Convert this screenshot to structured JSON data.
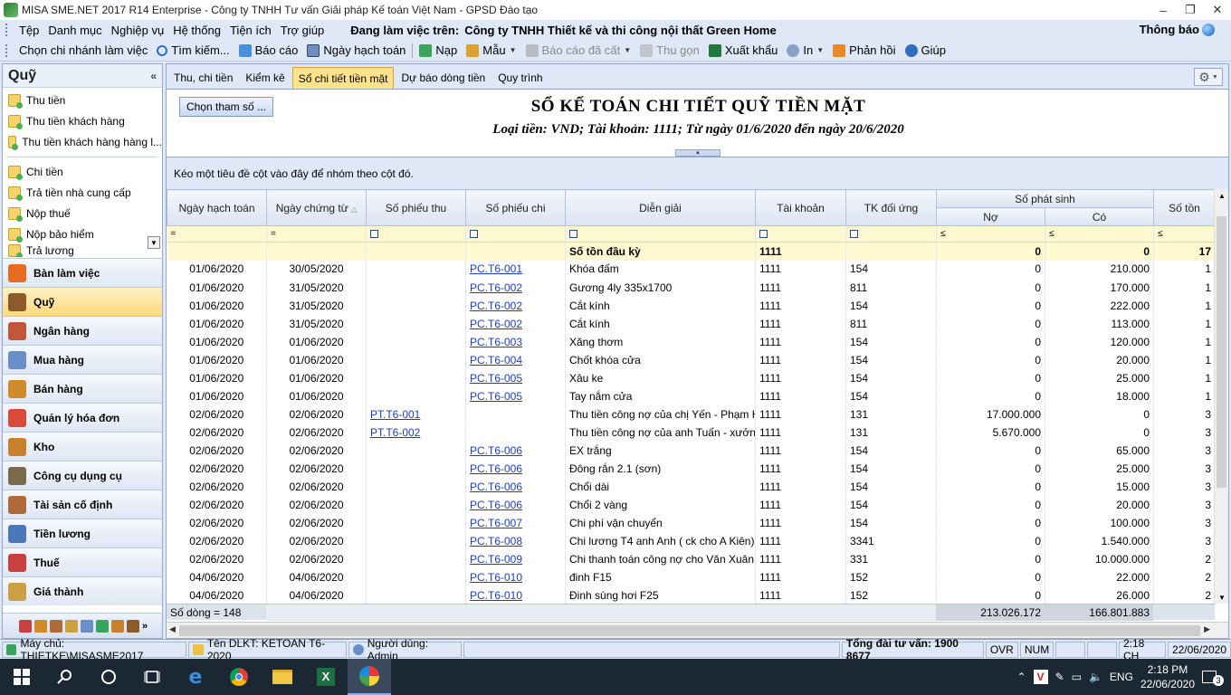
{
  "window": {
    "title": "MISA SME.NET 2017 R14 Enterprise - Công ty TNHH Tư vấn Giải pháp Kế toán Việt Nam - GPSD Đào tạo",
    "controls": [
      "–",
      "❐",
      "✕"
    ]
  },
  "menu": {
    "items": [
      "Tệp",
      "Danh mục",
      "Nghiệp vụ",
      "Hệ thống",
      "Tiện ích",
      "Trợ giúp"
    ],
    "working_label": "Đang làm việc trên:",
    "company": "Công ty TNHH Thiết kế và thi công nội thất Green Home",
    "notify": "Thông báo"
  },
  "toolbar": {
    "branch": "Chọn chi nhánh làm việc",
    "search": "Tìm kiếm...",
    "report": "Báo cáo",
    "date": "Ngày hạch toán",
    "load": "Nạp",
    "template": "Mẫu",
    "saved": "Báo cáo đã cất",
    "compact": "Thu gọn",
    "export": "Xuất khẩu",
    "print": "In",
    "feedback": "Phản hồi",
    "help": "Giúp"
  },
  "left": {
    "title": "Quỹ",
    "collapse": "«",
    "group1": [
      "Thu tiền",
      "Thu tiền khách hàng",
      "Thu tiền khách hàng hàng l..."
    ],
    "group2": [
      "Chi tiền",
      "Trả tiền nhà cung cấp",
      "Nộp thuế",
      "Nộp bảo hiểm",
      "Trả lương"
    ],
    "modules": [
      {
        "label": "Bàn làm việc",
        "color": "#e86b1f"
      },
      {
        "label": "Quỹ",
        "color": "#8d5a2b"
      },
      {
        "label": "Ngân hàng",
        "color": "#c2553a"
      },
      {
        "label": "Mua hàng",
        "color": "#6a8fc8"
      },
      {
        "label": "Bán hàng",
        "color": "#d08a2a"
      },
      {
        "label": "Quản lý hóa đơn",
        "color": "#d94a3a"
      },
      {
        "label": "Kho",
        "color": "#c9802a"
      },
      {
        "label": "Công cụ dụng cụ",
        "color": "#7a6a4a"
      },
      {
        "label": "Tài sản cố định",
        "color": "#b06a3a"
      },
      {
        "label": "Tiền lương",
        "color": "#4a78b8"
      },
      {
        "label": "Thuế",
        "color": "#c84040"
      },
      {
        "label": "Giá thành",
        "color": "#caa040"
      }
    ]
  },
  "tabs": [
    "Thu, chi tiền",
    "Kiểm kê",
    "Sổ chi tiết tiền mặt",
    "Dự báo dòng tiền",
    "Quy trình"
  ],
  "report": {
    "param_button": "Chọn tham số ...",
    "title": "SỔ KẾ TOÁN CHI TIẾT QUỸ TIỀN MẶT",
    "subtitle": "Loại tiền: VND; Tài khoản: 1111; Từ ngày 01/6/2020 đến ngày 20/6/2020",
    "group_hint": "Kéo một tiêu đề cột vào đây để nhóm theo cột đó."
  },
  "columns": {
    "post_date": "Ngày hạch toán",
    "doc_date": "Ngày chứng từ",
    "receipt_no": "Số phiếu thu",
    "payment_no": "Số phiếu chi",
    "desc": "Diễn giải",
    "account": "Tài khoản",
    "contra": "TK đối ứng",
    "arising": "Số phát sinh",
    "debit": "Nợ",
    "credit": "Có",
    "balance": "Số tồn"
  },
  "filters": {
    "eq": "=",
    "le": "≤"
  },
  "opening": {
    "label": "Số tồn đầu kỳ",
    "account": "1111",
    "debit": "0",
    "credit": "0",
    "balance": "17"
  },
  "rows": [
    {
      "post": "01/06/2020",
      "doc": "30/05/2020",
      "thu": "",
      "chi": "PC.T6-001",
      "desc": "Khóa đấm",
      "acc": "1111",
      "contra": "154",
      "debit": "0",
      "credit": "210.000",
      "bal": "1"
    },
    {
      "post": "01/06/2020",
      "doc": "31/05/2020",
      "thu": "",
      "chi": "PC.T6-002",
      "desc": "Gương 4ly 335x1700",
      "acc": "1111",
      "contra": "811",
      "debit": "0",
      "credit": "170.000",
      "bal": "1"
    },
    {
      "post": "01/06/2020",
      "doc": "31/05/2020",
      "thu": "",
      "chi": "PC.T6-002",
      "desc": "Cắt kính",
      "acc": "1111",
      "contra": "154",
      "debit": "0",
      "credit": "222.000",
      "bal": "1"
    },
    {
      "post": "01/06/2020",
      "doc": "31/05/2020",
      "thu": "",
      "chi": "PC.T6-002",
      "desc": "Cắt kính",
      "acc": "1111",
      "contra": "811",
      "debit": "0",
      "credit": "113.000",
      "bal": "1"
    },
    {
      "post": "01/06/2020",
      "doc": "01/06/2020",
      "thu": "",
      "chi": "PC.T6-003",
      "desc": "Xăng thơm",
      "acc": "1111",
      "contra": "154",
      "debit": "0",
      "credit": "120.000",
      "bal": "1"
    },
    {
      "post": "01/06/2020",
      "doc": "01/06/2020",
      "thu": "",
      "chi": "PC.T6-004",
      "desc": "Chốt khóa cửa",
      "acc": "1111",
      "contra": "154",
      "debit": "0",
      "credit": "20.000",
      "bal": "1"
    },
    {
      "post": "01/06/2020",
      "doc": "01/06/2020",
      "thu": "",
      "chi": "PC.T6-005",
      "desc": "Xâu ke",
      "acc": "1111",
      "contra": "154",
      "debit": "0",
      "credit": "25.000",
      "bal": "1"
    },
    {
      "post": "01/06/2020",
      "doc": "01/06/2020",
      "thu": "",
      "chi": "PC.T6-005",
      "desc": "Tay nắm cửa",
      "acc": "1111",
      "contra": "154",
      "debit": "0",
      "credit": "18.000",
      "bal": "1"
    },
    {
      "post": "02/06/2020",
      "doc": "02/06/2020",
      "thu": "PT.T6-001",
      "chi": "",
      "desc": "Thu tiền công nợ của chị Yến - Phạm H",
      "acc": "1111",
      "contra": "131",
      "debit": "17.000.000",
      "credit": "0",
      "bal": "3"
    },
    {
      "post": "02/06/2020",
      "doc": "02/06/2020",
      "thu": "PT.T6-002",
      "chi": "",
      "desc": "Thu tiền công nợ của anh Tuấn - xưởng",
      "acc": "1111",
      "contra": "131",
      "debit": "5.670.000",
      "credit": "0",
      "bal": "3"
    },
    {
      "post": "02/06/2020",
      "doc": "02/06/2020",
      "thu": "",
      "chi": "PC.T6-006",
      "desc": "EX trắng",
      "acc": "1111",
      "contra": "154",
      "debit": "0",
      "credit": "65.000",
      "bal": "3"
    },
    {
      "post": "02/06/2020",
      "doc": "02/06/2020",
      "thu": "",
      "chi": "PC.T6-006",
      "desc": "Đông rắn 2.1 (sơn)",
      "acc": "1111",
      "contra": "154",
      "debit": "0",
      "credit": "25.000",
      "bal": "3"
    },
    {
      "post": "02/06/2020",
      "doc": "02/06/2020",
      "thu": "",
      "chi": "PC.T6-006",
      "desc": "Chổi dài",
      "acc": "1111",
      "contra": "154",
      "debit": "0",
      "credit": "15.000",
      "bal": "3"
    },
    {
      "post": "02/06/2020",
      "doc": "02/06/2020",
      "thu": "",
      "chi": "PC.T6-006",
      "desc": "Chổi 2 vàng",
      "acc": "1111",
      "contra": "154",
      "debit": "0",
      "credit": "20.000",
      "bal": "3"
    },
    {
      "post": "02/06/2020",
      "doc": "02/06/2020",
      "thu": "",
      "chi": "PC.T6-007",
      "desc": "Chi phí vận chuyển",
      "acc": "1111",
      "contra": "154",
      "debit": "0",
      "credit": "100.000",
      "bal": "3"
    },
    {
      "post": "02/06/2020",
      "doc": "02/06/2020",
      "thu": "",
      "chi": "PC.T6-008",
      "desc": "Chi lương T4 anh Anh ( ck cho A Kiên)",
      "acc": "1111",
      "contra": "3341",
      "debit": "0",
      "credit": "1.540.000",
      "bal": "3"
    },
    {
      "post": "02/06/2020",
      "doc": "02/06/2020",
      "thu": "",
      "chi": "PC.T6-009",
      "desc": "Chi thanh toán công nợ cho Văn Xuân",
      "acc": "1111",
      "contra": "331",
      "debit": "0",
      "credit": "10.000.000",
      "bal": "2"
    },
    {
      "post": "04/06/2020",
      "doc": "04/06/2020",
      "thu": "",
      "chi": "PC.T6-010",
      "desc": "đinh F15",
      "acc": "1111",
      "contra": "152",
      "debit": "0",
      "credit": "22.000",
      "bal": "2"
    },
    {
      "post": "04/06/2020",
      "doc": "04/06/2020",
      "thu": "",
      "chi": "PC.T6-010",
      "desc": "Đinh súng hơi F25",
      "acc": "1111",
      "contra": "152",
      "debit": "0",
      "credit": "26.000",
      "bal": "2"
    }
  ],
  "footer": {
    "row_count": "Số dòng = 148",
    "debit_total": "213.026.172",
    "credit_total": "166.801.883"
  },
  "status": {
    "server": "Máy chủ: THIETKE\\MISASME2017",
    "db": "Tên DLKT: KETOAN T6-2020",
    "user": "Người dùng: Admin",
    "hotline": "Tổng đài tư vấn: 1900 8677",
    "ovr": "OVR",
    "num": "NUM",
    "time": "2:18 CH",
    "date": "22/06/2020"
  },
  "taskbar": {
    "lang": "ENG",
    "time": "2:18 PM",
    "date": "22/06/2020",
    "badge": "3"
  }
}
